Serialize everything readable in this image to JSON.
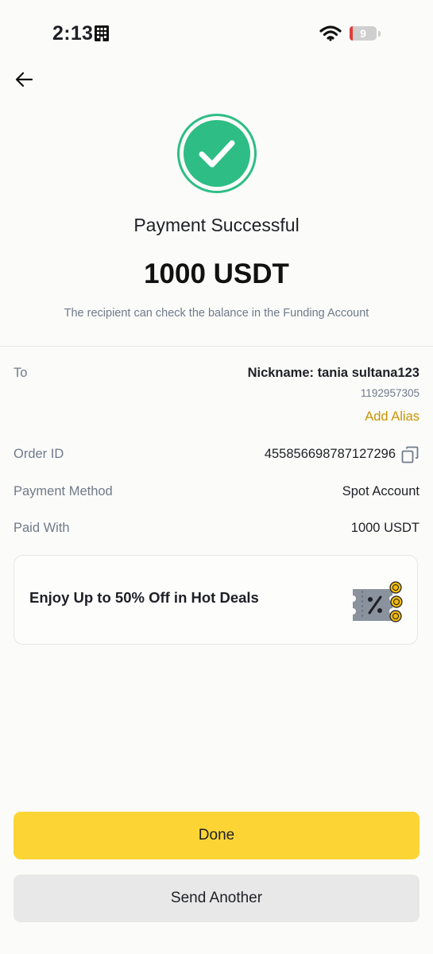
{
  "status_bar": {
    "time": "2:13",
    "battery": "9",
    "icons": [
      "building-icon",
      "wifi-icon",
      "battery-icon"
    ]
  },
  "header": {
    "back_icon": "arrow-left-icon"
  },
  "result": {
    "icon": "check-circle-icon",
    "title": "Payment Successful",
    "amount": "1000 USDT",
    "subtitle": "The recipient can check the balance in the Funding Account"
  },
  "details": {
    "to_label": "To",
    "nickname": "Nickname: tania sultana123",
    "uid": "1192957305",
    "add_alias": "Add Alias",
    "order_id_label": "Order ID",
    "order_id": "455856698787127296",
    "payment_method_label": "Payment Method",
    "payment_method": "Spot Account",
    "paid_with_label": "Paid With",
    "paid_with": "1000 USDT"
  },
  "promo": {
    "text": "Enjoy Up to 50% Off in Hot Deals",
    "icon": "coupon-icon"
  },
  "actions": {
    "done": "Done",
    "send_another": "Send Another"
  },
  "colors": {
    "accent": "#fcd535",
    "success": "#2ebd85",
    "link": "#c99400",
    "secondary_text": "#707a8a"
  }
}
